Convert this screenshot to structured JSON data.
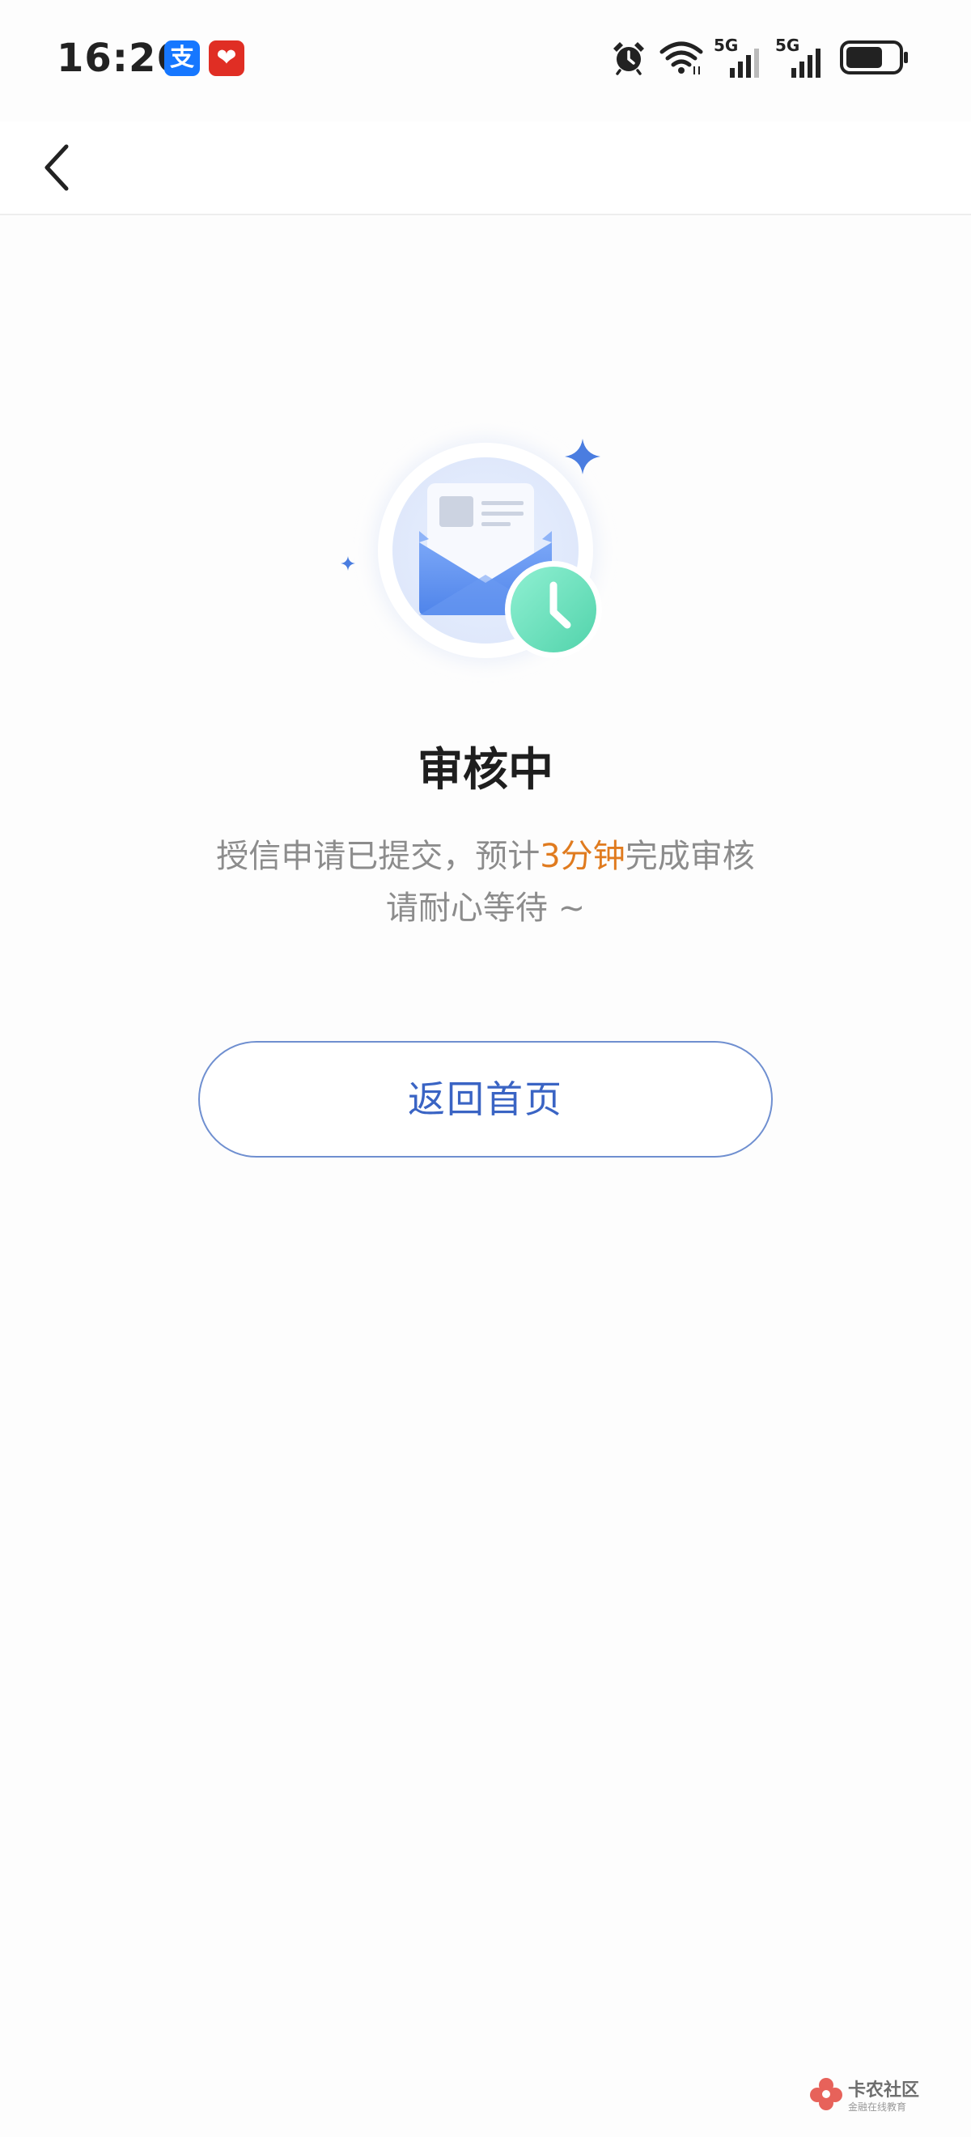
{
  "status_bar": {
    "time": "16:26",
    "apps": [
      {
        "name": "alipay",
        "glyph": "支",
        "color": "#1677ff"
      },
      {
        "name": "pinduoduo",
        "glyph": "❤",
        "color": "#e02e24"
      }
    ],
    "icons": [
      "alarm-icon",
      "wifi-icon",
      "cellular-5g-icon",
      "cellular-5g-icon",
      "battery-icon"
    ],
    "network_label_1": "5G",
    "network_label_2": "5G"
  },
  "nav": {
    "back_icon": "chevron-left-icon"
  },
  "illustration": {
    "icon": "envelope-clock-icon",
    "colors": {
      "envelope": "#5b8ff0",
      "clock": "#6fdcbc",
      "sparkle": "#4a7de0"
    }
  },
  "status": {
    "title": "审核中",
    "line1_prefix": "授信申请已提交，预计",
    "line1_highlight": "3分钟",
    "line1_suffix": "完成审核",
    "line2": "请耐心等待 ~"
  },
  "actions": {
    "home_button_label": "返回首页"
  },
  "watermark": {
    "text": "卡农社区",
    "subtext": "金融在线教育"
  },
  "colors": {
    "accent": "#3a64c4",
    "highlight": "#e07b1f",
    "text_secondary": "#8c8c8c"
  }
}
